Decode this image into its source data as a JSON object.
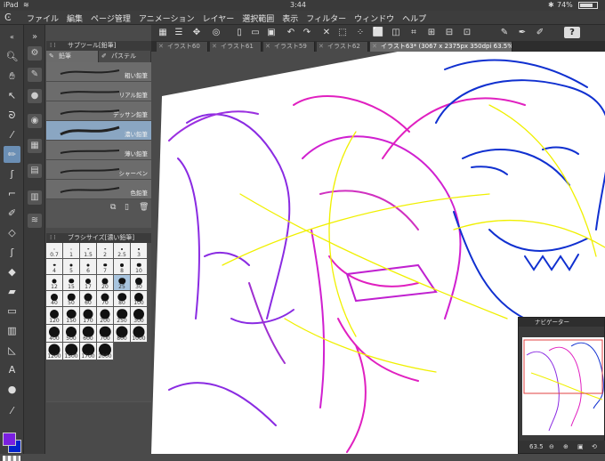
{
  "status": {
    "device": "iPad",
    "time": "3:44",
    "battery": "74%"
  },
  "menu": [
    "ファイル",
    "編集",
    "ページ管理",
    "アニメーション",
    "レイヤー",
    "選択範囲",
    "表示",
    "フィルター",
    "ウィンドウ",
    "ヘルプ"
  ],
  "help_icon": "?",
  "tabs": [
    {
      "label": "イラスト60"
    },
    {
      "label": "イラスト61"
    },
    {
      "label": "イラスト59"
    },
    {
      "label": "イラスト62"
    },
    {
      "label": "イラスト63* (3067 x 2375px 350dpi 63.5%)"
    }
  ],
  "subtool_panel": {
    "title": "サブツール[鉛筆]",
    "tab_pencil": "鉛筆",
    "tab_pastel": "パステル",
    "brushes": [
      {
        "label": "粗い鉛筆"
      },
      {
        "label": "リアル鉛筆"
      },
      {
        "label": "デッサン鉛筆"
      },
      {
        "label": "濃い鉛筆"
      },
      {
        "label": "薄い鉛筆"
      },
      {
        "label": "シャーペン"
      },
      {
        "label": "色鉛筆"
      }
    ]
  },
  "brush_size_panel": {
    "title": "ブラシサイズ[濃い鉛筆]",
    "sizes": [
      "0.7",
      "1",
      "1.5",
      "2",
      "2.5",
      "3",
      "4",
      "5",
      "6",
      "7",
      "8",
      "10",
      "12",
      "15",
      "17",
      "20",
      "25",
      "30",
      "40",
      "50",
      "60",
      "70",
      "80",
      "100",
      "120",
      "150",
      "170",
      "200",
      "250",
      "300",
      "400",
      "500",
      "600",
      "700",
      "800",
      "1000",
      "1200",
      "1500",
      "1700",
      "2000"
    ],
    "selected": "25"
  },
  "navigator": {
    "title": "ナビゲーター",
    "zoom": "63.5"
  },
  "colors": {
    "main": "#7a1fe0",
    "sub": "#0022cc",
    "accent": "#6b8fb5"
  }
}
